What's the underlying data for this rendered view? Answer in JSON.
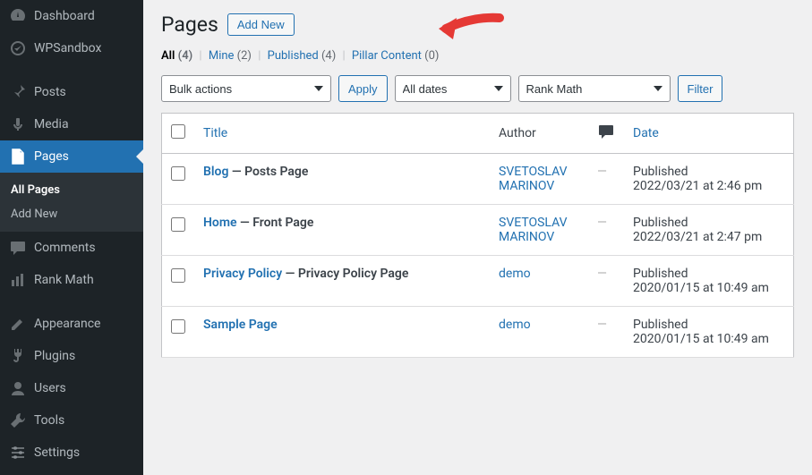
{
  "sidebar": {
    "items": [
      {
        "icon": "dashboard",
        "label": "Dashboard"
      },
      {
        "icon": "wpsandbox",
        "label": "WPSandbox"
      },
      {
        "sep": true
      },
      {
        "icon": "pin",
        "label": "Posts"
      },
      {
        "icon": "media",
        "label": "Media"
      },
      {
        "icon": "page",
        "label": "Pages",
        "current": true
      },
      {
        "icon": "comment",
        "label": "Comments"
      },
      {
        "icon": "rankmath",
        "label": "Rank Math"
      },
      {
        "sep": true
      },
      {
        "icon": "appearance",
        "label": "Appearance"
      },
      {
        "icon": "plugins",
        "label": "Plugins"
      },
      {
        "icon": "users",
        "label": "Users"
      },
      {
        "icon": "tools",
        "label": "Tools"
      },
      {
        "icon": "settings",
        "label": "Settings"
      }
    ],
    "submenu": [
      {
        "label": "All Pages",
        "current": true
      },
      {
        "label": "Add New"
      }
    ]
  },
  "page": {
    "title": "Pages",
    "add_new_label": "Add New"
  },
  "filters": {
    "all_label": "All",
    "all_count": "(4)",
    "mine_label": "Mine",
    "mine_count": "(2)",
    "published_label": "Published",
    "published_count": "(4)",
    "pillar_label": "Pillar Content",
    "pillar_count": "(0)"
  },
  "actions": {
    "bulk_label": "Bulk actions",
    "apply_label": "Apply",
    "dates_label": "All dates",
    "rank_label": "Rank Math",
    "filter_label": "Filter"
  },
  "columns": {
    "title": "Title",
    "author": "Author",
    "date": "Date"
  },
  "rows": [
    {
      "title": "Blog",
      "suffix": " — Posts Page",
      "author": "SVETOSLAV MARINOV",
      "status": "Published",
      "date": "2022/03/21 at 2:46 pm"
    },
    {
      "title": "Home",
      "suffix": " — Front Page",
      "author": "SVETOSLAV MARINOV",
      "status": "Published",
      "date": "2022/03/21 at 2:47 pm"
    },
    {
      "title": "Privacy Policy",
      "suffix": " — Privacy Policy Page",
      "author": "demo",
      "status": "Published",
      "date": "2020/01/15 at 10:49 am"
    },
    {
      "title": "Sample Page",
      "suffix": "",
      "author": "demo",
      "status": "Published",
      "date": "2020/01/15 at 10:49 am"
    }
  ],
  "colors": {
    "accent": "#2271b1",
    "annotation": "#e53935"
  }
}
